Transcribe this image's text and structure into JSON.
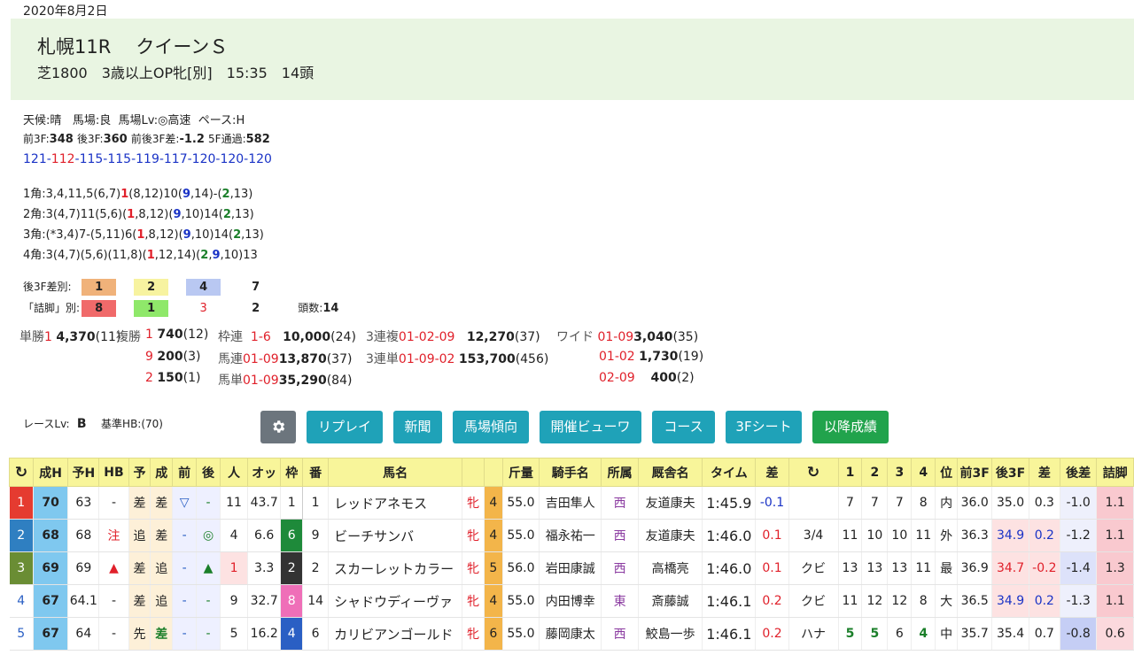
{
  "date": "2020年8月2日",
  "race": {
    "title1": "札幌11R",
    "title2": "クイーンＳ",
    "info": [
      "芝1800",
      "3歳以上OP牝[別]",
      "15:35",
      "14頭"
    ]
  },
  "cond": {
    "weather_l": "天候:",
    "weather": "晴",
    "track_l": "馬場:",
    "track": "良",
    "lv_l": "馬場Lv:",
    "lv": "◎高速",
    "pace_l": "ペース:",
    "pace": "H"
  },
  "times": {
    "f3_l": "前3F:",
    "f3": "348",
    "l3_l": "後3F:",
    "l3": "360",
    "diff_l": "前後3F差:",
    "diff": "-1.2",
    "f5_l": "5F通過:",
    "f5": "582"
  },
  "laps": [
    {
      "v": "121",
      "c": "blue"
    },
    {
      "v": "-",
      "c": "blue"
    },
    {
      "v": "112",
      "c": "red"
    },
    {
      "v": "-115-115-119-117-120-120-120",
      "c": "blue"
    }
  ],
  "corners": [
    [
      {
        "t": "1角:3,4,11,5(6,7)"
      },
      {
        "t": "1",
        "c": "red"
      },
      {
        "t": "(8,12)10("
      },
      {
        "t": "9",
        "c": "blue"
      },
      {
        "t": ",14)-("
      },
      {
        "t": "2",
        "c": "grn"
      },
      {
        "t": ",13)"
      }
    ],
    [
      {
        "t": "2角:3(4,7)11(5,6)("
      },
      {
        "t": "1",
        "c": "red"
      },
      {
        "t": ",8,12)("
      },
      {
        "t": "9",
        "c": "blue"
      },
      {
        "t": ",10)14("
      },
      {
        "t": "2",
        "c": "grn"
      },
      {
        "t": ",13)"
      }
    ],
    [
      {
        "t": "3角:(*3,4)7-(5,11)6("
      },
      {
        "t": "1",
        "c": "red"
      },
      {
        "t": ",8,12)("
      },
      {
        "t": "9",
        "c": "blue"
      },
      {
        "t": ",10)14("
      },
      {
        "t": "2",
        "c": "grn"
      },
      {
        "t": ",13)"
      }
    ],
    [
      {
        "t": "4角:3(4,7)(5,6)(11,8)("
      },
      {
        "t": "1",
        "c": "red"
      },
      {
        "t": ",12,14)("
      },
      {
        "t": "2",
        "c": "grn"
      },
      {
        "t": ","
      },
      {
        "t": "9",
        "c": "blue"
      },
      {
        "t": ",10)13"
      }
    ]
  ],
  "agari": {
    "label": "後3F差別:",
    "chips": [
      "1",
      "2",
      "4",
      "7"
    ],
    "colors": [
      "#f0b27a",
      "#f7f3a0",
      "#b9c8f2",
      "transparent"
    ]
  },
  "tsume": {
    "label": "「詰脚」別:",
    "chips": [
      "8",
      "1",
      "3",
      "2"
    ],
    "colors": [
      "#f06a6a",
      "#8fe86a",
      "transparent",
      "transparent"
    ],
    "count_l": "頭数:",
    "count": "14"
  },
  "pay": {
    "tan_l": "単勝",
    "tan_n": "1",
    "tan_v": "4,370",
    "tan_p": "(11)",
    "fuku_l": "複勝",
    "fuku": [
      {
        "n": "1",
        "v": "740",
        "p": "(12)"
      },
      {
        "n": "9",
        "v": "200",
        "p": "(3)"
      },
      {
        "n": "2",
        "v": "150",
        "p": "(1)"
      }
    ],
    "waku_l": "枠連",
    "waku_n": "1-6",
    "waku_v": "10,000",
    "waku_p": "(24)",
    "uren_l": "馬連",
    "uren_n": "01-09",
    "uren_v": "13,870",
    "uren_p": "(37)",
    "utan_l": "馬単",
    "utan_n": "01-09",
    "utan_v": "35,290",
    "utan_p": "(84)",
    "sfuku_l": "3連複",
    "sfuku_n": "01-02-09",
    "sfuku_v": "12,270",
    "sfuku_p": "(37)",
    "stan_l": "3連単",
    "stan_n": "01-09-02",
    "stan_v": "153,700",
    "stan_p": "(456)",
    "wide_l": "ワイド",
    "wide": [
      {
        "n": "01-09",
        "v": "3,040",
        "p": "(35)"
      },
      {
        "n": "01-02",
        "v": "1,730",
        "p": "(19)"
      },
      {
        "n": "02-09",
        "v": "400",
        "p": "(2)"
      }
    ]
  },
  "racelv": {
    "l": "レースLv:",
    "v": "B",
    "hb_l": "基準HB:",
    "hb": "(70)"
  },
  "buttons": {
    "settings": "gear-icon",
    "replay": "リプレイ",
    "news": "新聞",
    "trend": "馬場傾向",
    "viewer": "開催ビューワ",
    "course": "コース",
    "sheet": "3Fシート",
    "later": "以降成績"
  },
  "columns": [
    "↻",
    "成H",
    "予H",
    "HB",
    "予",
    "成",
    "前",
    "後",
    "人",
    "オッ",
    "枠",
    "番",
    "馬名",
    "",
    "",
    "斤量",
    "騎手名",
    "所属",
    "厩舎名",
    "タイム",
    "差",
    "↻",
    "1",
    "2",
    "3",
    "4",
    "位",
    "前3F",
    "後3F",
    "差",
    "後差",
    "詰脚"
  ],
  "rows": [
    [
      "1",
      "70",
      "63",
      "-",
      "差",
      "差",
      "▽",
      "-",
      "11",
      "43.7",
      "1",
      "1",
      "レッドアネモス",
      "牝",
      "4",
      "55.0",
      "吉田隼人",
      "西",
      "友道康夫",
      "1:45.9",
      "-0.1",
      "",
      "7",
      "7",
      "7",
      "8",
      "内",
      "36.0",
      "35.0",
      "0.3",
      "-1.0",
      "1.1"
    ],
    [
      "2",
      "68",
      "68",
      "注",
      "追",
      "差",
      "-",
      "◎",
      "4",
      "6.6",
      "6",
      "9",
      "ビーチサンバ",
      "牝",
      "4",
      "55.0",
      "福永祐一",
      "西",
      "友道康夫",
      "1:46.0",
      "0.1",
      "3/4",
      "11",
      "10",
      "10",
      "11",
      "外",
      "36.3",
      "34.9",
      "0.2",
      "-1.2",
      "1.1"
    ],
    [
      "3",
      "69",
      "69",
      "▲",
      "差",
      "追",
      "-",
      "▲",
      "1",
      "3.3",
      "2",
      "2",
      "スカーレットカラー",
      "牝",
      "5",
      "56.0",
      "岩田康誠",
      "西",
      "高橋亮",
      "1:46.0",
      "0.1",
      "クビ",
      "13",
      "13",
      "13",
      "11",
      "最",
      "36.9",
      "34.7",
      "-0.2",
      "-1.4",
      "1.3"
    ],
    [
      "4",
      "67",
      "64.1",
      "-",
      "差",
      "追",
      "-",
      "-",
      "9",
      "32.7",
      "8",
      "14",
      "シャドウディーヴァ",
      "牝",
      "4",
      "55.0",
      "内田博幸",
      "東",
      "斎藤誠",
      "1:46.1",
      "0.2",
      "クビ",
      "11",
      "12",
      "12",
      "8",
      "大",
      "36.5",
      "34.9",
      "0.2",
      "-1.3",
      "1.1"
    ],
    [
      "5",
      "67",
      "64",
      "-",
      "先",
      "差",
      "-",
      "-",
      "5",
      "16.2",
      "4",
      "6",
      "カリビアンゴールド",
      "牝",
      "6",
      "55.0",
      "藤岡康太",
      "西",
      "鮫島一歩",
      "1:46.1",
      "0.2",
      "ハナ",
      "5",
      "5",
      "6",
      "4",
      "中",
      "35.7",
      "35.4",
      "0.7",
      "-0.8",
      "0.6"
    ]
  ]
}
